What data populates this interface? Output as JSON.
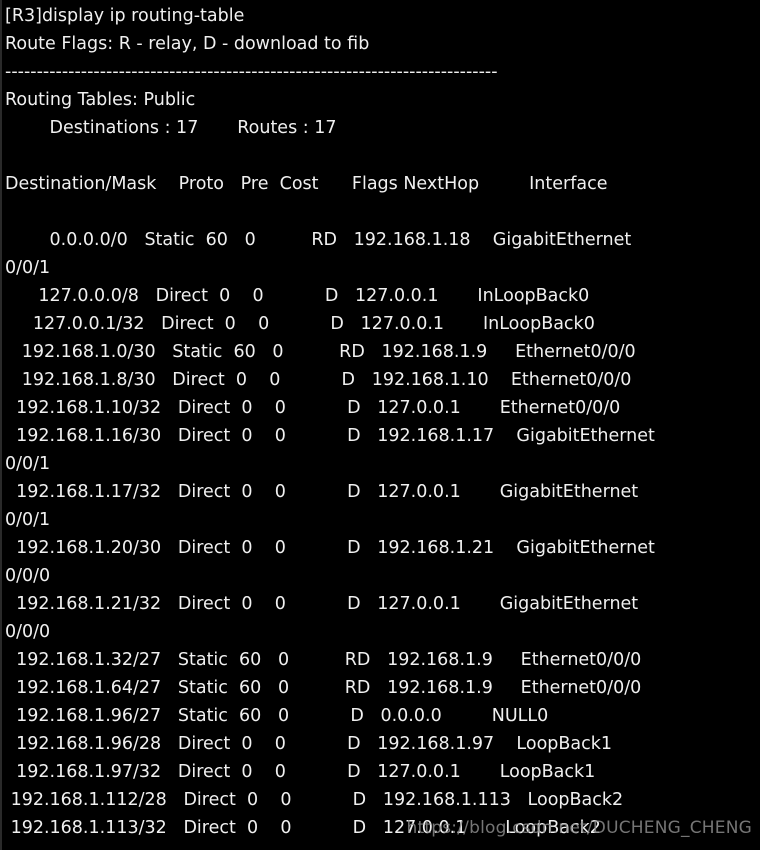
{
  "terminal": {
    "background_color": "#000000",
    "text_color": "#f0f0f0",
    "watermark_color": "#8a8a8a",
    "prompt_line": "[R3]display ip routing-table",
    "route_flags_line": "Route Flags: R - relay, D - download to fib",
    "separator_line": "------------------------------------------------------------------------------",
    "routing_tables_line": "Routing Tables: Public",
    "counts_line": "        Destinations : 17       Routes : 17",
    "header_line": "Destination/Mask    Proto   Pre  Cost      Flags NextHop         Interface",
    "watermark": "https://blog.csdn.net/DUCHENG_CHENG"
  },
  "summary": {
    "router_name": "[R3]",
    "command": "display ip routing-table",
    "table_scope": "Public",
    "destinations_label": "Destinations",
    "destinations": "17",
    "routes_label": "Routes",
    "routes": "17",
    "flag_relay": "R - relay",
    "flag_download": "D - download to fib"
  },
  "table": {
    "columns": [
      "Destination/Mask",
      "Proto",
      "Pre",
      "Cost",
      "Flags",
      "NextHop",
      "Interface"
    ],
    "rows": [
      {
        "dest": "0.0.0.0/0",
        "proto": "Static",
        "pre": "60",
        "cost": "0",
        "flags": "RD",
        "nexthop": "192.168.1.18",
        "interface": "GigabitEthernet",
        "interface_cont": "0/0/1"
      },
      {
        "dest": "127.0.0.0/8",
        "proto": "Direct",
        "pre": "0",
        "cost": "0",
        "flags": "D",
        "nexthop": "127.0.0.1",
        "interface": "InLoopBack0",
        "interface_cont": ""
      },
      {
        "dest": "127.0.0.1/32",
        "proto": "Direct",
        "pre": "0",
        "cost": "0",
        "flags": "D",
        "nexthop": "127.0.0.1",
        "interface": "InLoopBack0",
        "interface_cont": ""
      },
      {
        "dest": "192.168.1.0/30",
        "proto": "Static",
        "pre": "60",
        "cost": "0",
        "flags": "RD",
        "nexthop": "192.168.1.9",
        "interface": "Ethernet0/0/0",
        "interface_cont": ""
      },
      {
        "dest": "192.168.1.8/30",
        "proto": "Direct",
        "pre": "0",
        "cost": "0",
        "flags": "D",
        "nexthop": "192.168.1.10",
        "interface": "Ethernet0/0/0",
        "interface_cont": ""
      },
      {
        "dest": "192.168.1.10/32",
        "proto": "Direct",
        "pre": "0",
        "cost": "0",
        "flags": "D",
        "nexthop": "127.0.0.1",
        "interface": "Ethernet0/0/0",
        "interface_cont": ""
      },
      {
        "dest": "192.168.1.16/30",
        "proto": "Direct",
        "pre": "0",
        "cost": "0",
        "flags": "D",
        "nexthop": "192.168.1.17",
        "interface": "GigabitEthernet",
        "interface_cont": "0/0/1"
      },
      {
        "dest": "192.168.1.17/32",
        "proto": "Direct",
        "pre": "0",
        "cost": "0",
        "flags": "D",
        "nexthop": "127.0.0.1",
        "interface": "GigabitEthernet",
        "interface_cont": "0/0/1"
      },
      {
        "dest": "192.168.1.20/30",
        "proto": "Direct",
        "pre": "0",
        "cost": "0",
        "flags": "D",
        "nexthop": "192.168.1.21",
        "interface": "GigabitEthernet",
        "interface_cont": "0/0/0"
      },
      {
        "dest": "192.168.1.21/32",
        "proto": "Direct",
        "pre": "0",
        "cost": "0",
        "flags": "D",
        "nexthop": "127.0.0.1",
        "interface": "GigabitEthernet",
        "interface_cont": "0/0/0"
      },
      {
        "dest": "192.168.1.32/27",
        "proto": "Static",
        "pre": "60",
        "cost": "0",
        "flags": "RD",
        "nexthop": "192.168.1.9",
        "interface": "Ethernet0/0/0",
        "interface_cont": ""
      },
      {
        "dest": "192.168.1.64/27",
        "proto": "Static",
        "pre": "60",
        "cost": "0",
        "flags": "RD",
        "nexthop": "192.168.1.9",
        "interface": "Ethernet0/0/0",
        "interface_cont": ""
      },
      {
        "dest": "192.168.1.96/27",
        "proto": "Static",
        "pre": "60",
        "cost": "0",
        "flags": "D",
        "nexthop": "0.0.0.0",
        "interface": "NULL0",
        "interface_cont": ""
      },
      {
        "dest": "192.168.1.96/28",
        "proto": "Direct",
        "pre": "0",
        "cost": "0",
        "flags": "D",
        "nexthop": "192.168.1.97",
        "interface": "LoopBack1",
        "interface_cont": ""
      },
      {
        "dest": "192.168.1.97/32",
        "proto": "Direct",
        "pre": "0",
        "cost": "0",
        "flags": "D",
        "nexthop": "127.0.0.1",
        "interface": "LoopBack1",
        "interface_cont": ""
      },
      {
        "dest": "192.168.1.112/28",
        "proto": "Direct",
        "pre": "0",
        "cost": "0",
        "flags": "D",
        "nexthop": "192.168.1.113",
        "interface": "LoopBack2",
        "interface_cont": ""
      },
      {
        "dest": "192.168.1.113/32",
        "proto": "Direct",
        "pre": "0",
        "cost": "0",
        "flags": "D",
        "nexthop": "127.0.0.1",
        "interface": "LoopBack2",
        "interface_cont": ""
      }
    ]
  },
  "rendered_lines": [
    "[R3]display ip routing-table",
    "Route Flags: R - relay, D - download to fib",
    "------------------------------------------------------------------------------",
    "Routing Tables: Public",
    "        Destinations : 17       Routes : 17",
    "",
    "Destination/Mask    Proto   Pre  Cost      Flags NextHop         Interface",
    "",
    "        0.0.0.0/0   Static  60   0          RD   192.168.1.18    GigabitEthernet",
    "0/0/1",
    "      127.0.0.0/8   Direct  0    0           D   127.0.0.1       InLoopBack0",
    "     127.0.0.1/32   Direct  0    0           D   127.0.0.1       InLoopBack0",
    "   192.168.1.0/30   Static  60   0          RD   192.168.1.9     Ethernet0/0/0",
    "   192.168.1.8/30   Direct  0    0           D   192.168.1.10    Ethernet0/0/0",
    "  192.168.1.10/32   Direct  0    0           D   127.0.0.1       Ethernet0/0/0",
    "  192.168.1.16/30   Direct  0    0           D   192.168.1.17    GigabitEthernet",
    "0/0/1",
    "  192.168.1.17/32   Direct  0    0           D   127.0.0.1       GigabitEthernet",
    "0/0/1",
    "  192.168.1.20/30   Direct  0    0           D   192.168.1.21    GigabitEthernet",
    "0/0/0",
    "  192.168.1.21/32   Direct  0    0           D   127.0.0.1       GigabitEthernet",
    "0/0/0",
    "  192.168.1.32/27   Static  60   0          RD   192.168.1.9     Ethernet0/0/0",
    "  192.168.1.64/27   Static  60   0          RD   192.168.1.9     Ethernet0/0/0",
    "  192.168.1.96/27   Static  60   0           D   0.0.0.0         NULL0",
    "  192.168.1.96/28   Direct  0    0           D   192.168.1.97    LoopBack1",
    "  192.168.1.97/32   Direct  0    0           D   127.0.0.1       LoopBack1",
    " 192.168.1.112/28   Direct  0    0           D   192.168.1.113   LoopBack2",
    " 192.168.1.113/32   Direct  0    0           D   127.0.0.1       LoopBack2"
  ]
}
